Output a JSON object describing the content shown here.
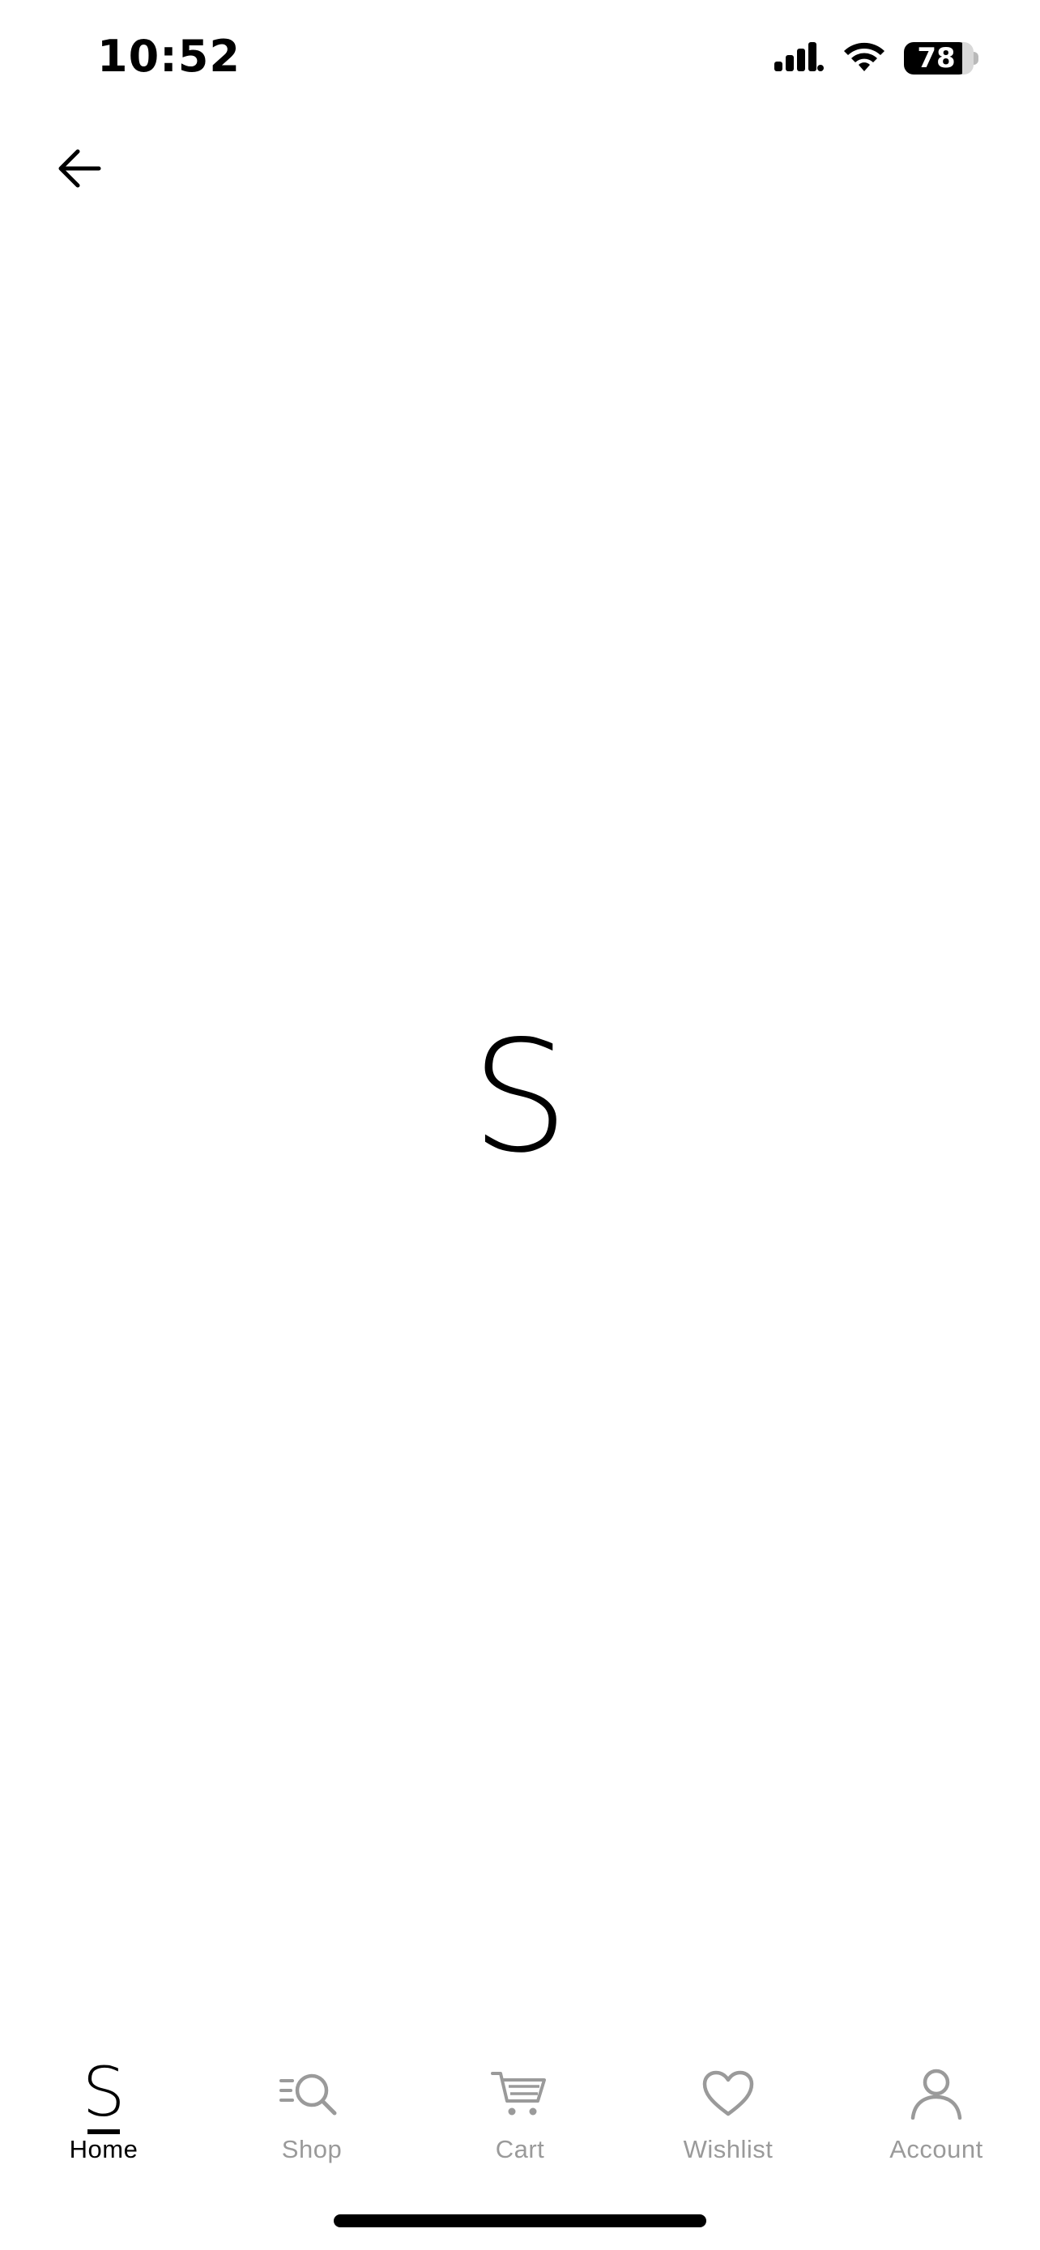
{
  "status_bar": {
    "time": "10:52",
    "battery_level": "78",
    "icons": [
      "cellular-signal-icon",
      "wifi-icon",
      "battery-icon"
    ]
  },
  "header": {
    "back_icon": "arrow-left-icon"
  },
  "main": {
    "logo_text": "S"
  },
  "tab_bar": {
    "active_tab": "Home",
    "tabs": [
      {
        "label": "Home",
        "icon": "home-logo-icon"
      },
      {
        "label": "Shop",
        "icon": "shop-search-icon"
      },
      {
        "label": "Cart",
        "icon": "cart-icon"
      },
      {
        "label": "Wishlist",
        "icon": "heart-icon"
      },
      {
        "label": "Account",
        "icon": "person-icon"
      }
    ],
    "home_logo": "S"
  },
  "colors": {
    "background": "#ffffff",
    "active": "#000000",
    "inactive": "#9a9a9a"
  }
}
